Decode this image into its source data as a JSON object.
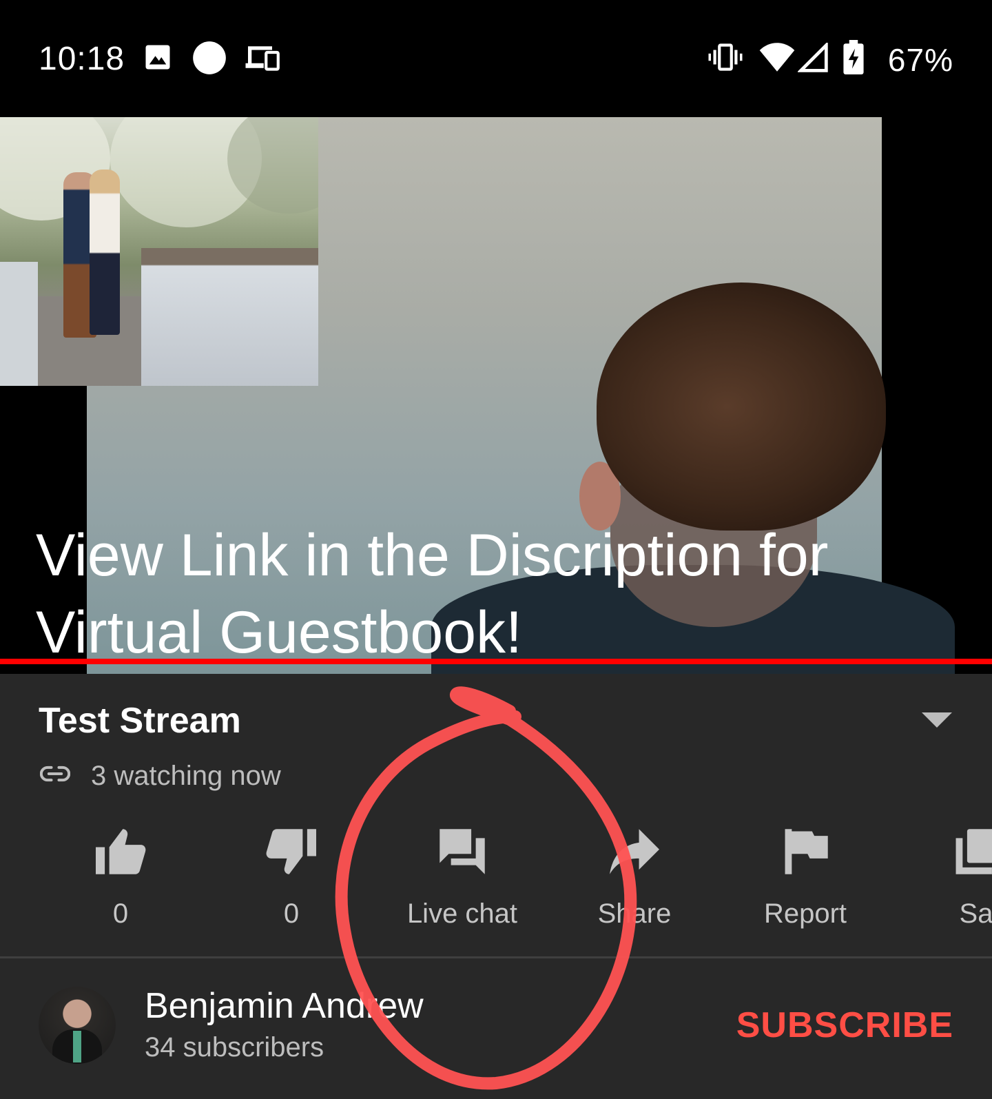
{
  "status_bar": {
    "time": "10:18",
    "battery_text": "67%",
    "icons": [
      "image-icon",
      "circle-notification-icon",
      "devices-icon",
      "vibrate-icon",
      "wifi-icon",
      "cell-signal-icon",
      "battery-charging-icon"
    ]
  },
  "video": {
    "caption": "View Link in the Discription for Virtual Guestbook!",
    "progress_color": "#ff0000"
  },
  "info": {
    "title": "Test Stream",
    "watching": "3 watching now"
  },
  "actions": [
    {
      "icon": "thumbs-up-icon",
      "label": "0"
    },
    {
      "icon": "thumbs-down-icon",
      "label": "0"
    },
    {
      "icon": "live-chat-icon",
      "label": "Live chat"
    },
    {
      "icon": "share-icon",
      "label": "Share"
    },
    {
      "icon": "report-flag-icon",
      "label": "Report"
    },
    {
      "icon": "save-icon",
      "label": "Sa"
    }
  ],
  "channel": {
    "name": "Benjamin Andrew",
    "subscribers": "34 subscribers",
    "subscribe_label": "SUBSCRIBE",
    "subscribe_color": "#ff4e45"
  },
  "annotation": {
    "color": "#ff5252"
  }
}
